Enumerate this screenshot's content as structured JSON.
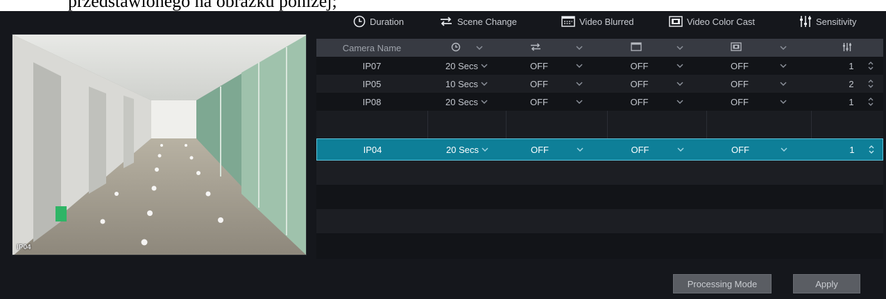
{
  "doc_fragment": "przedstawionego na obrazku poniżej;",
  "legend": [
    {
      "icon": "clock-icon",
      "label": "Duration"
    },
    {
      "icon": "scene-change-icon",
      "label": "Scene Change"
    },
    {
      "icon": "video-blurred-icon",
      "label": "Video Blurred"
    },
    {
      "icon": "color-cast-icon",
      "label": "Video Color Cast"
    },
    {
      "icon": "sensitivity-icon",
      "label": "Sensitivity"
    }
  ],
  "preview": {
    "camera_label": "IP04"
  },
  "table": {
    "header": {
      "camera_name": "Camera Name"
    },
    "rows": [
      {
        "camera": "IP07",
        "duration": "20 Secs",
        "scene_change": "OFF",
        "video_blurred": "OFF",
        "color_cast": "OFF",
        "sensitivity": "1"
      },
      {
        "camera": "IP05",
        "duration": "10 Secs",
        "scene_change": "OFF",
        "video_blurred": "OFF",
        "color_cast": "OFF",
        "sensitivity": "2"
      },
      {
        "camera": "IP08",
        "duration": "20 Secs",
        "scene_change": "OFF",
        "video_blurred": "OFF",
        "color_cast": "OFF",
        "sensitivity": "1"
      },
      {
        "camera": "IP04",
        "duration": "20 Secs",
        "scene_change": "OFF",
        "video_blurred": "OFF",
        "color_cast": "OFF",
        "sensitivity": "1"
      }
    ],
    "selected_row": 3
  },
  "buttons": {
    "processing_mode": "Processing Mode",
    "apply": "Apply"
  },
  "colors": {
    "background": "#15171c",
    "header": "#373a42",
    "selected": "#0e7f98"
  }
}
